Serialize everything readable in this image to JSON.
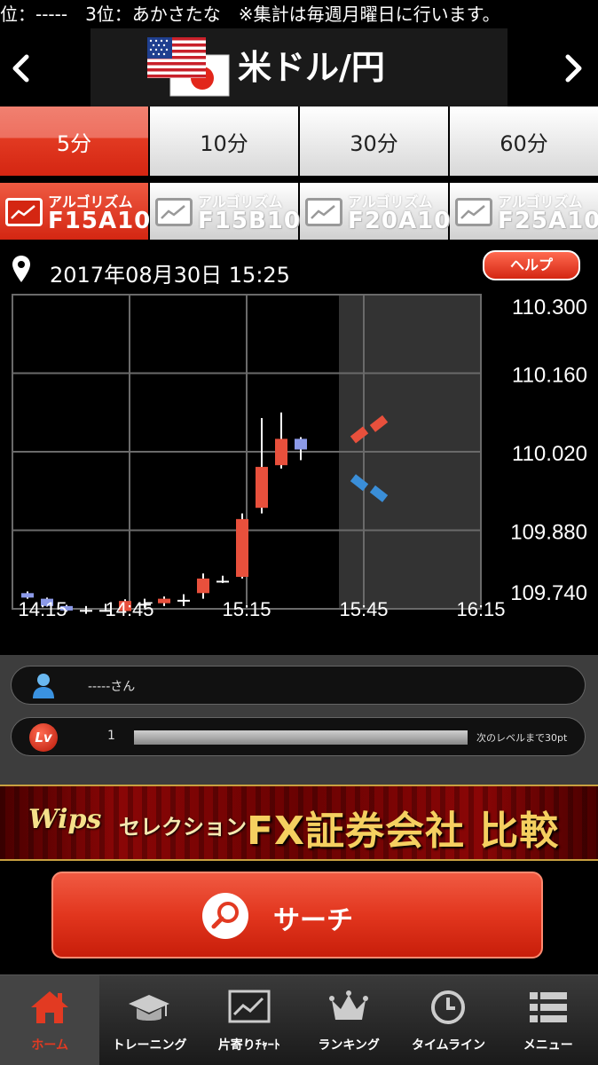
{
  "ticker": {
    "text": "位：-----　3位：あかさたな　※集計は毎週月曜日に行います。"
  },
  "header": {
    "pair_title": "米ドル/円",
    "prev_label": "‹",
    "next_label": "›"
  },
  "timeframe_tabs": [
    {
      "label": "5分",
      "active": true
    },
    {
      "label": "10分",
      "active": false
    },
    {
      "label": "30分",
      "active": false
    },
    {
      "label": "60分",
      "active": false
    }
  ],
  "algorithm_tabs": [
    {
      "small": "アルゴリズム",
      "name": "F15A10",
      "active": true
    },
    {
      "small": "アルゴリズム",
      "name": "F15B10",
      "active": false
    },
    {
      "small": "アルゴリズム",
      "name": "F20A10",
      "active": false
    },
    {
      "small": "アルゴリズム",
      "name": "F25A10",
      "active": false
    }
  ],
  "date_row": {
    "datetime": "2017年08月30日 15:25",
    "help_label": "ヘルプ"
  },
  "chart_data": {
    "type": "candlestick",
    "x_ticks": [
      "14:15",
      "14:45",
      "15:15",
      "15:45",
      "16:15"
    ],
    "y_ticks": [
      "110.300",
      "110.160",
      "110.020",
      "109.880",
      "109.740"
    ],
    "ylim": [
      109.74,
      110.3
    ],
    "candles": [
      {
        "t": "14:15",
        "open": 109.768,
        "close": 109.76,
        "high": 109.771,
        "low": 109.758
      },
      {
        "t": "14:20",
        "open": 109.758,
        "close": 109.745,
        "high": 109.76,
        "low": 109.744
      },
      {
        "t": "14:25",
        "open": 109.745,
        "close": 109.737,
        "high": 109.747,
        "low": 109.735
      },
      {
        "t": "14:30",
        "open": 109.738,
        "close": 109.738,
        "high": 109.745,
        "low": 109.731
      },
      {
        "t": "14:35",
        "open": 109.738,
        "close": 109.738,
        "high": 109.749,
        "low": 109.735
      },
      {
        "t": "14:40",
        "open": 109.736,
        "close": 109.754,
        "high": 109.757,
        "low": 109.733
      },
      {
        "t": "14:45",
        "open": 109.749,
        "close": 109.749,
        "high": 109.758,
        "low": 109.742
      },
      {
        "t": "14:50",
        "open": 109.75,
        "close": 109.758,
        "high": 109.762,
        "low": 109.745
      },
      {
        "t": "14:55",
        "open": 109.756,
        "close": 109.756,
        "high": 109.766,
        "low": 109.745
      },
      {
        "t": "15:00",
        "open": 109.768,
        "close": 109.794,
        "high": 109.803,
        "low": 109.758
      },
      {
        "t": "15:05",
        "open": 109.79,
        "close": 109.79,
        "high": 109.799,
        "low": 109.786
      },
      {
        "t": "15:10",
        "open": 109.797,
        "close": 109.9,
        "high": 109.91,
        "low": 109.794
      },
      {
        "t": "15:15",
        "open": 109.92,
        "close": 109.993,
        "high": 110.08,
        "low": 109.91
      },
      {
        "t": "15:20",
        "open": 109.996,
        "close": 110.043,
        "high": 110.09,
        "low": 109.99
      },
      {
        "t": "15:25",
        "open": 110.043,
        "close": 110.024,
        "high": 110.046,
        "low": 110.005
      }
    ],
    "forecast_up": [
      {
        "t": "15:40",
        "value": 110.05
      },
      {
        "t": "15:45",
        "value": 110.07
      }
    ],
    "forecast_down": [
      {
        "t": "15:40",
        "value": 109.965
      },
      {
        "t": "15:45",
        "value": 109.945
      }
    ],
    "forecast_region_start": "15:40",
    "colors": {
      "up": "#e8503c",
      "down": "#8c9ae8",
      "doji": "#ffffff",
      "forecast_up": "#e8503c",
      "forecast_down": "#3a8ed8",
      "grid": "#6a6a6a"
    }
  },
  "user_panel": {
    "user_name": "-----さん",
    "level": "1",
    "level_icon": "Lv",
    "level_progress": 0,
    "next_level_text": "次のレベルまで30pt"
  },
  "banner": {
    "logo": "Wips",
    "selection": "セレクション",
    "main": "FX証券会社 比較"
  },
  "search": {
    "label": "サーチ"
  },
  "bottom_nav": [
    {
      "label": "ホーム",
      "icon": "home-icon",
      "active": true
    },
    {
      "label": "トレーニング",
      "icon": "graduation-cap-icon",
      "active": false
    },
    {
      "label": "片寄りﾁｬｰﾄ",
      "icon": "chart-icon",
      "active": false
    },
    {
      "label": "ランキング",
      "icon": "crown-icon",
      "active": false
    },
    {
      "label": "タイムライン",
      "icon": "clock-icon",
      "active": false
    },
    {
      "label": "メニュー",
      "icon": "menu-icon",
      "active": false
    }
  ]
}
